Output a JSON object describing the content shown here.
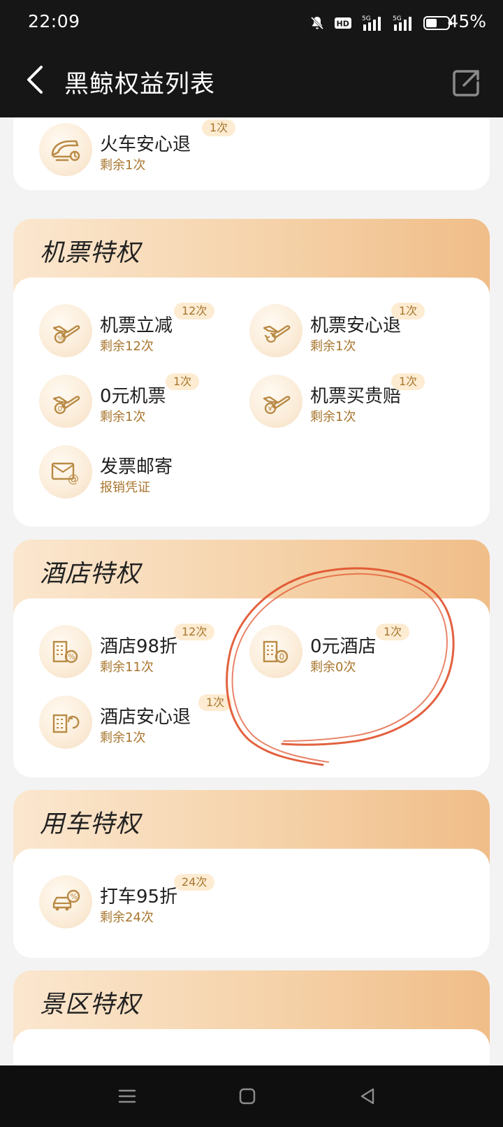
{
  "status_bar": {
    "time": "22:09",
    "battery": "45%",
    "icons": [
      "bell-muted-icon",
      "hd-icon",
      "signal-5g-icon",
      "signal-5g-icon",
      "battery-icon"
    ]
  },
  "header": {
    "title": "黑鲸权益列表",
    "back_icon": "chevron-left-icon",
    "share_icon": "share-icon"
  },
  "top_card": {
    "items": [
      {
        "name": "火车安心退",
        "sub": "剩余1次",
        "badge": "1次",
        "icon": "train-icon"
      }
    ]
  },
  "sections": [
    {
      "title": "机票特权",
      "items": [
        {
          "name": "机票立减",
          "sub": "剩余12次",
          "badge": "12次",
          "icon": "plane-discount-icon"
        },
        {
          "name": "机票安心退",
          "sub": "剩余1次",
          "badge": "1次",
          "icon": "plane-refund-icon"
        },
        {
          "name": "0元机票",
          "sub": "剩余1次",
          "badge": "1次",
          "icon": "plane-free-icon"
        },
        {
          "name": "机票买贵赔",
          "sub": "剩余1次",
          "badge": "1次",
          "icon": "plane-price-icon"
        },
        {
          "name": "发票邮寄",
          "sub": "报销凭证",
          "badge": "",
          "icon": "invoice-mail-icon"
        }
      ]
    },
    {
      "title": "酒店特权",
      "items": [
        {
          "name": "酒店98折",
          "sub": "剩余11次",
          "badge": "12次",
          "icon": "hotel-discount-icon"
        },
        {
          "name": "0元酒店",
          "sub": "剩余0次",
          "badge": "1次",
          "icon": "hotel-free-icon"
        },
        {
          "name": "酒店安心退",
          "sub": "剩余1次",
          "badge": "1次",
          "icon": "hotel-refund-icon"
        }
      ]
    },
    {
      "title": "用车特权",
      "items": [
        {
          "name": "打车95折",
          "sub": "剩余24次",
          "badge": "24次",
          "icon": "car-discount-icon"
        }
      ]
    },
    {
      "title": "景区特权",
      "items": []
    }
  ],
  "nav_bar": {
    "icons": [
      "menu-icon",
      "home-square-icon",
      "back-triangle-icon"
    ]
  },
  "colors": {
    "accent": "#a8762e",
    "badge_bg": "#fdecd2",
    "section_gradient_start": "#fbe7cf",
    "section_gradient_end": "#f0bd88",
    "annotation": "#e0502a"
  }
}
